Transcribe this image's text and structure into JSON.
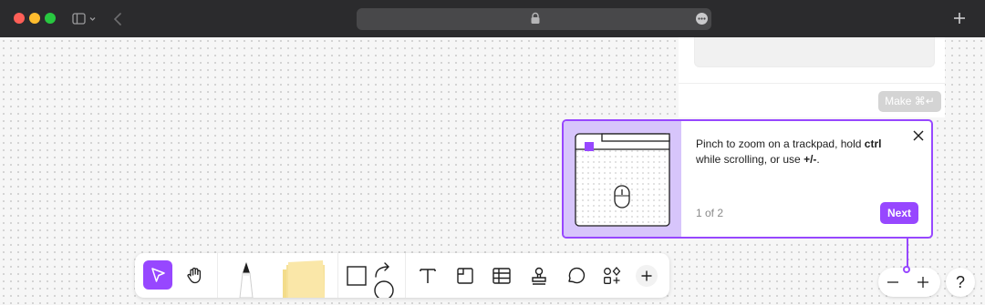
{
  "browser": {
    "icons": [
      "close-dot",
      "minimize-dot",
      "zoom-dot",
      "sidebar-icon",
      "chevron-down-icon",
      "back-icon",
      "lock-icon",
      "more-icon",
      "new-tab-icon"
    ]
  },
  "side_panel": {
    "make_button_label": "Make ⌘↵"
  },
  "tour": {
    "text_part1": "Pinch to zoom on a trackpad, hold ",
    "text_bold1": "ctrl",
    "text_part2": " while scrolling, or use ",
    "text_bold2": "+/-",
    "text_part3": ".",
    "step": "1 of 2",
    "next_label": "Next",
    "accent": "#9747ff",
    "illustration_bg": "#d7c5fb"
  },
  "zoom": {
    "help_label": "?"
  },
  "toolbar": {
    "tools": [
      "select",
      "hand",
      "pen",
      "sticky-note",
      "shapes",
      "text",
      "section",
      "table",
      "stamp",
      "comment",
      "widgets",
      "more"
    ],
    "active_tool": "select"
  }
}
